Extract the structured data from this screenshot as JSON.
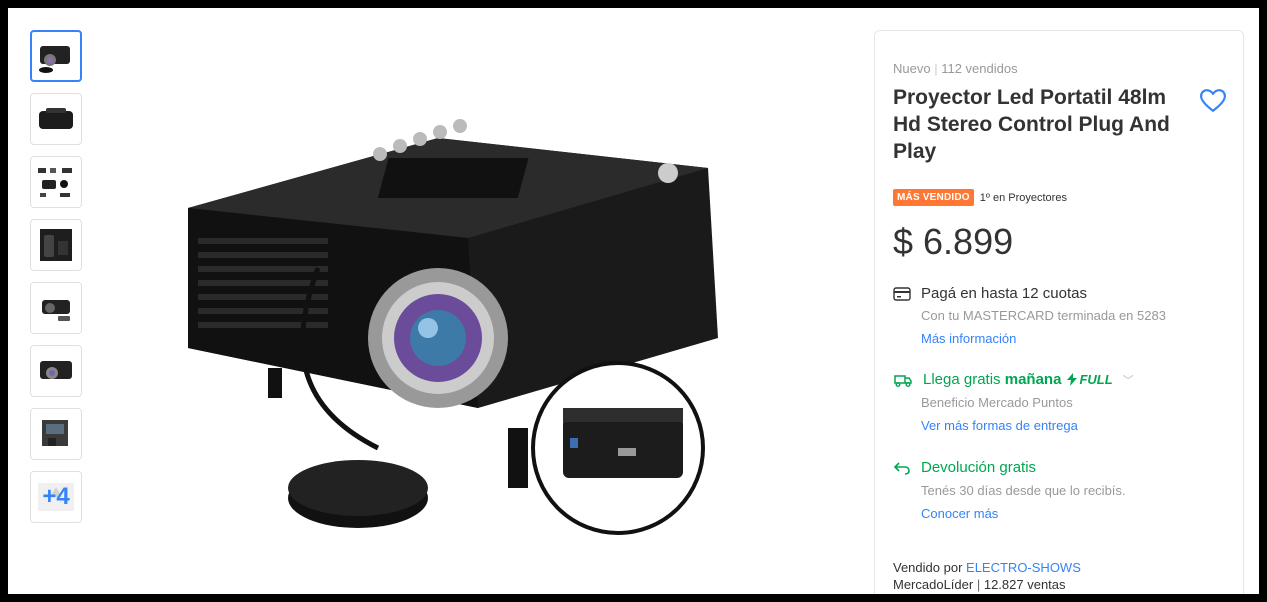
{
  "thumbnails": {
    "more_label": "+4"
  },
  "product": {
    "condition": "Nuevo",
    "sold": "112 vendidos",
    "title": "Proyector Led Portatil 48lm Hd Stereo Control Plug And Play",
    "badge": "MÁS VENDIDO",
    "rank": "1º en Proyectores",
    "price": "$ 6.899",
    "installments": "Pagá en hasta 12 cuotas",
    "card_info": "Con tu MASTERCARD terminada en 5283",
    "more_info": "Más información",
    "shipping_prefix": "Llega gratis",
    "shipping_day": "mañana",
    "full_label": "FULL",
    "shipping_benefit": "Beneficio Mercado Puntos",
    "shipping_more": "Ver más formas de entrega",
    "returns_title": "Devolución gratis",
    "returns_sub": "Tenés 30 días desde que lo recibís.",
    "returns_link": "Conocer más",
    "seller_prefix": "Vendido por",
    "seller_name": "ELECTRO-SHOWS",
    "seller_status": "MercadoLíder",
    "seller_sales": "12.827 ventas"
  },
  "colors": {
    "accent": "#3483fa",
    "green": "#00a650",
    "badge": "#ff7733"
  },
  "icons": [
    "heart-icon",
    "card-icon",
    "truck-icon",
    "bolt-icon",
    "return-icon",
    "chevron-down-icon"
  ]
}
